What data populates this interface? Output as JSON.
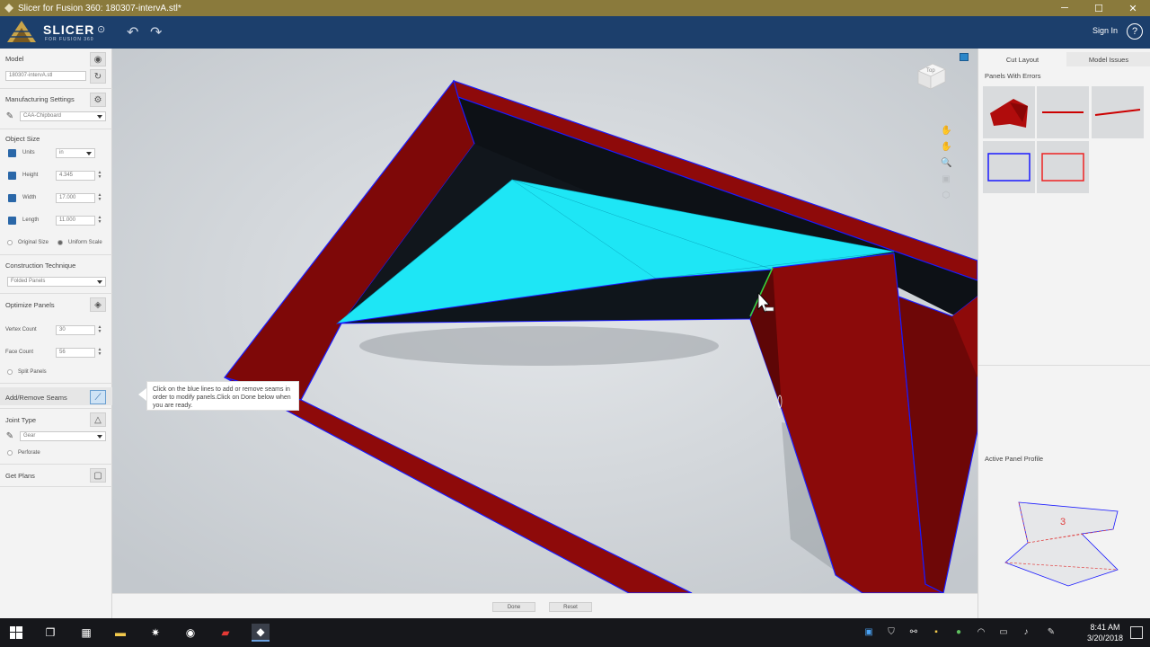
{
  "window": {
    "title": "Slicer for Fusion 360: 180307-intervA.stl*",
    "min_glyph": "─",
    "max_glyph": "☐",
    "close_glyph": "✕"
  },
  "toolbar": {
    "logo_main": "SLICER",
    "logo_sub": "FOR FUSION 360",
    "settings_glyph": "⊙",
    "undo_glyph": "↶",
    "redo_glyph": "↷",
    "sign_in": "Sign In",
    "help": "?"
  },
  "left_panel": {
    "model_label": "Model",
    "model_file": "180307-intervA.stl",
    "manufacturing_label": "Manufacturing Settings",
    "material": "CAA-Chipboard",
    "object_size_label": "Object Size",
    "units_label": "Units",
    "units_value": "in",
    "height_label": "Height",
    "height_value": "4.345",
    "width_label": "Width",
    "width_value": "17.000",
    "length_label": "Length",
    "length_value": "11.000",
    "original_size": "Original Size",
    "uniform_scale": "Uniform Scale",
    "construction_label": "Construction Technique",
    "construction_value": "Folded Panels",
    "optimize_label": "Optimize Panels",
    "vertex_label": "Vertex Count",
    "vertex_value": "30",
    "face_label": "Face Count",
    "face_value": "56",
    "split_panels": "Split Panels",
    "seams_label": "Add/Remove Seams",
    "joint_label": "Joint Type",
    "joint_value": "Gear",
    "perforate": "Perforate",
    "get_plans": "Get Plans"
  },
  "viewport": {
    "tooltip": "Click on the blue lines to add or remove seams in order to modify panels.Click on Done below when you are ready.",
    "viewcube_label": "Top"
  },
  "bottom_bar": {
    "done": "Done",
    "reset": "Reset"
  },
  "right_panel": {
    "tab_cut_layout": "Cut Layout",
    "tab_model_issues": "Model Issues",
    "panels_with_errors": "Panels With Errors",
    "active_panel_profile": "Active Panel Profile",
    "profile_number": "3"
  },
  "taskbar": {
    "time": "8:41 AM",
    "date": "3/20/2018"
  },
  "colors": {
    "title_bar": "#8a7a3c",
    "app_toolbar": "#1c3f6c",
    "model_red": "#8e0a0a",
    "panel_cyan": "#1ee6f5",
    "seam_blue": "#1a1aff",
    "taskbar": "#16171b"
  }
}
